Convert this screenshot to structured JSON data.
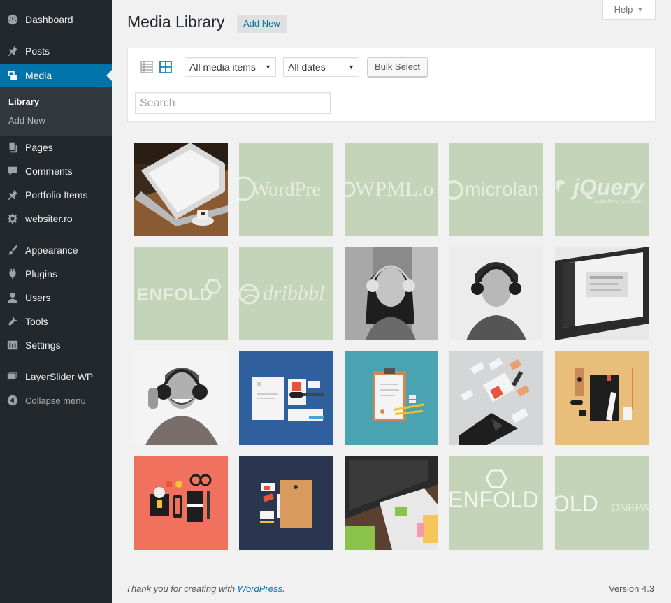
{
  "sidebar": {
    "items": [
      {
        "label": "Dashboard",
        "icon": "dashboard-icon"
      },
      {
        "label": "Posts",
        "icon": "pin-icon"
      },
      {
        "label": "Media",
        "icon": "media-icon"
      },
      {
        "label": "Pages",
        "icon": "page-icon"
      },
      {
        "label": "Comments",
        "icon": "comment-icon"
      },
      {
        "label": "Portfolio Items",
        "icon": "pin-icon"
      },
      {
        "label": "websiter.ro",
        "icon": "gear-icon"
      },
      {
        "label": "Appearance",
        "icon": "brush-icon"
      },
      {
        "label": "Plugins",
        "icon": "plugin-icon"
      },
      {
        "label": "Users",
        "icon": "user-icon"
      },
      {
        "label": "Tools",
        "icon": "wrench-icon"
      },
      {
        "label": "Settings",
        "icon": "settings-icon"
      },
      {
        "label": "LayerSlider WP",
        "icon": "layers-icon"
      },
      {
        "label": "Collapse menu",
        "icon": "collapse-icon"
      }
    ],
    "submenu": [
      {
        "label": "Library"
      },
      {
        "label": "Add New"
      }
    ],
    "active_color": "#0073aa",
    "background": "#23282d"
  },
  "header": {
    "title": "Media Library",
    "add_new": "Add New",
    "help": "Help"
  },
  "toolbar": {
    "filter_type": "All media items",
    "filter_date": "All dates",
    "bulk_select": "Bulk Select",
    "search_placeholder": "Search"
  },
  "media_tiles": [
    {
      "name": "laptop-photo"
    },
    {
      "name": "wordpress-logo",
      "text": "WordPre"
    },
    {
      "name": "wpml-logo",
      "text": "WPML.o"
    },
    {
      "name": "microlancer-logo",
      "text": "microlan"
    },
    {
      "name": "jquery-logo",
      "text": "jQuery",
      "subtext": "write less, do more."
    },
    {
      "name": "enfold-logo",
      "text": "ENFOLD"
    },
    {
      "name": "dribbble-logo",
      "text": "dribbbl"
    },
    {
      "name": "woman-headphones-photo"
    },
    {
      "name": "man-headphones-photo"
    },
    {
      "name": "laptop-screen-photo"
    },
    {
      "name": "smiling-man-headphones-photo"
    },
    {
      "name": "stationery-blue"
    },
    {
      "name": "clipboard-teal"
    },
    {
      "name": "brand-identity-grey"
    },
    {
      "name": "stationery-orange"
    },
    {
      "name": "stationery-coral"
    },
    {
      "name": "envelope-navy"
    },
    {
      "name": "desk-keyboard-photo"
    },
    {
      "name": "enfold-white-logo",
      "text": "ENFOLD"
    },
    {
      "name": "enfold-onepage-logo",
      "text": "OLD",
      "subtext": "ONEPA"
    }
  ],
  "footer": {
    "thanks_prefix": "Thank you for creating with ",
    "thanks_link": "WordPress",
    "thanks_suffix": ".",
    "version": "Version 4.3"
  }
}
